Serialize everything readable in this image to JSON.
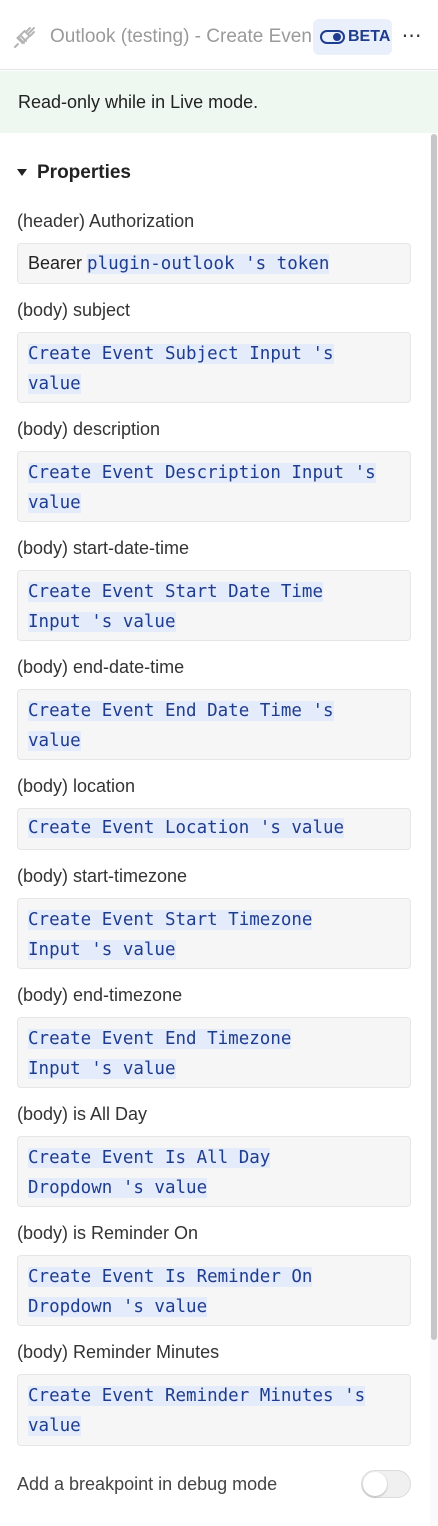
{
  "header": {
    "title": "Outlook (testing) - Create Event",
    "beta_label": "BETA",
    "more_label": "⋯",
    "plug_icon": "plug-disconnected-icon"
  },
  "banner": {
    "text": "Read-only while in Live mode."
  },
  "properties": {
    "title": "Properties",
    "items": [
      {
        "label": "(header) Authorization",
        "prefix": "Bearer ",
        "lines": [
          "plugin-outlook 's token"
        ]
      },
      {
        "label": "(body) subject",
        "prefix": "",
        "lines": [
          " Create Event Subject Input 's",
          "value"
        ]
      },
      {
        "label": "(body) description",
        "prefix": "",
        "lines": [
          " Create Event Description Input 's",
          "value"
        ]
      },
      {
        "label": "(body) start-date-time",
        "prefix": "",
        "lines": [
          " Create Event Start Date Time",
          "Input 's value"
        ]
      },
      {
        "label": "(body) end-date-time",
        "prefix": "",
        "lines": [
          " Create Event End Date Time 's",
          "value"
        ]
      },
      {
        "label": "(body) location",
        "prefix": "",
        "lines": [
          " Create Event Location 's value"
        ]
      },
      {
        "label": "(body) start-timezone",
        "prefix": "",
        "lines": [
          " Create Event Start Timezone",
          "Input 's value"
        ]
      },
      {
        "label": "(body) end-timezone",
        "prefix": "",
        "lines": [
          " Create Event End Timezone",
          "Input 's value"
        ]
      },
      {
        "label": "(body) is All Day",
        "prefix": "",
        "lines": [
          " Create Event Is All Day",
          "Dropdown 's value"
        ]
      },
      {
        "label": "(body) is Reminder On",
        "prefix": "",
        "lines": [
          " Create Event Is Reminder On",
          "Dropdown 's value"
        ]
      },
      {
        "label": "(body) Reminder Minutes",
        "prefix": "",
        "lines": [
          " Create Event Reminder Minutes 's",
          "value"
        ]
      }
    ]
  },
  "breakpoint": {
    "label": "Add a breakpoint in debug mode",
    "enabled": false
  },
  "colors": {
    "accent": "#1f3d8f",
    "banner_bg": "#eef7f0",
    "token_bg": "#e4ebfa"
  }
}
